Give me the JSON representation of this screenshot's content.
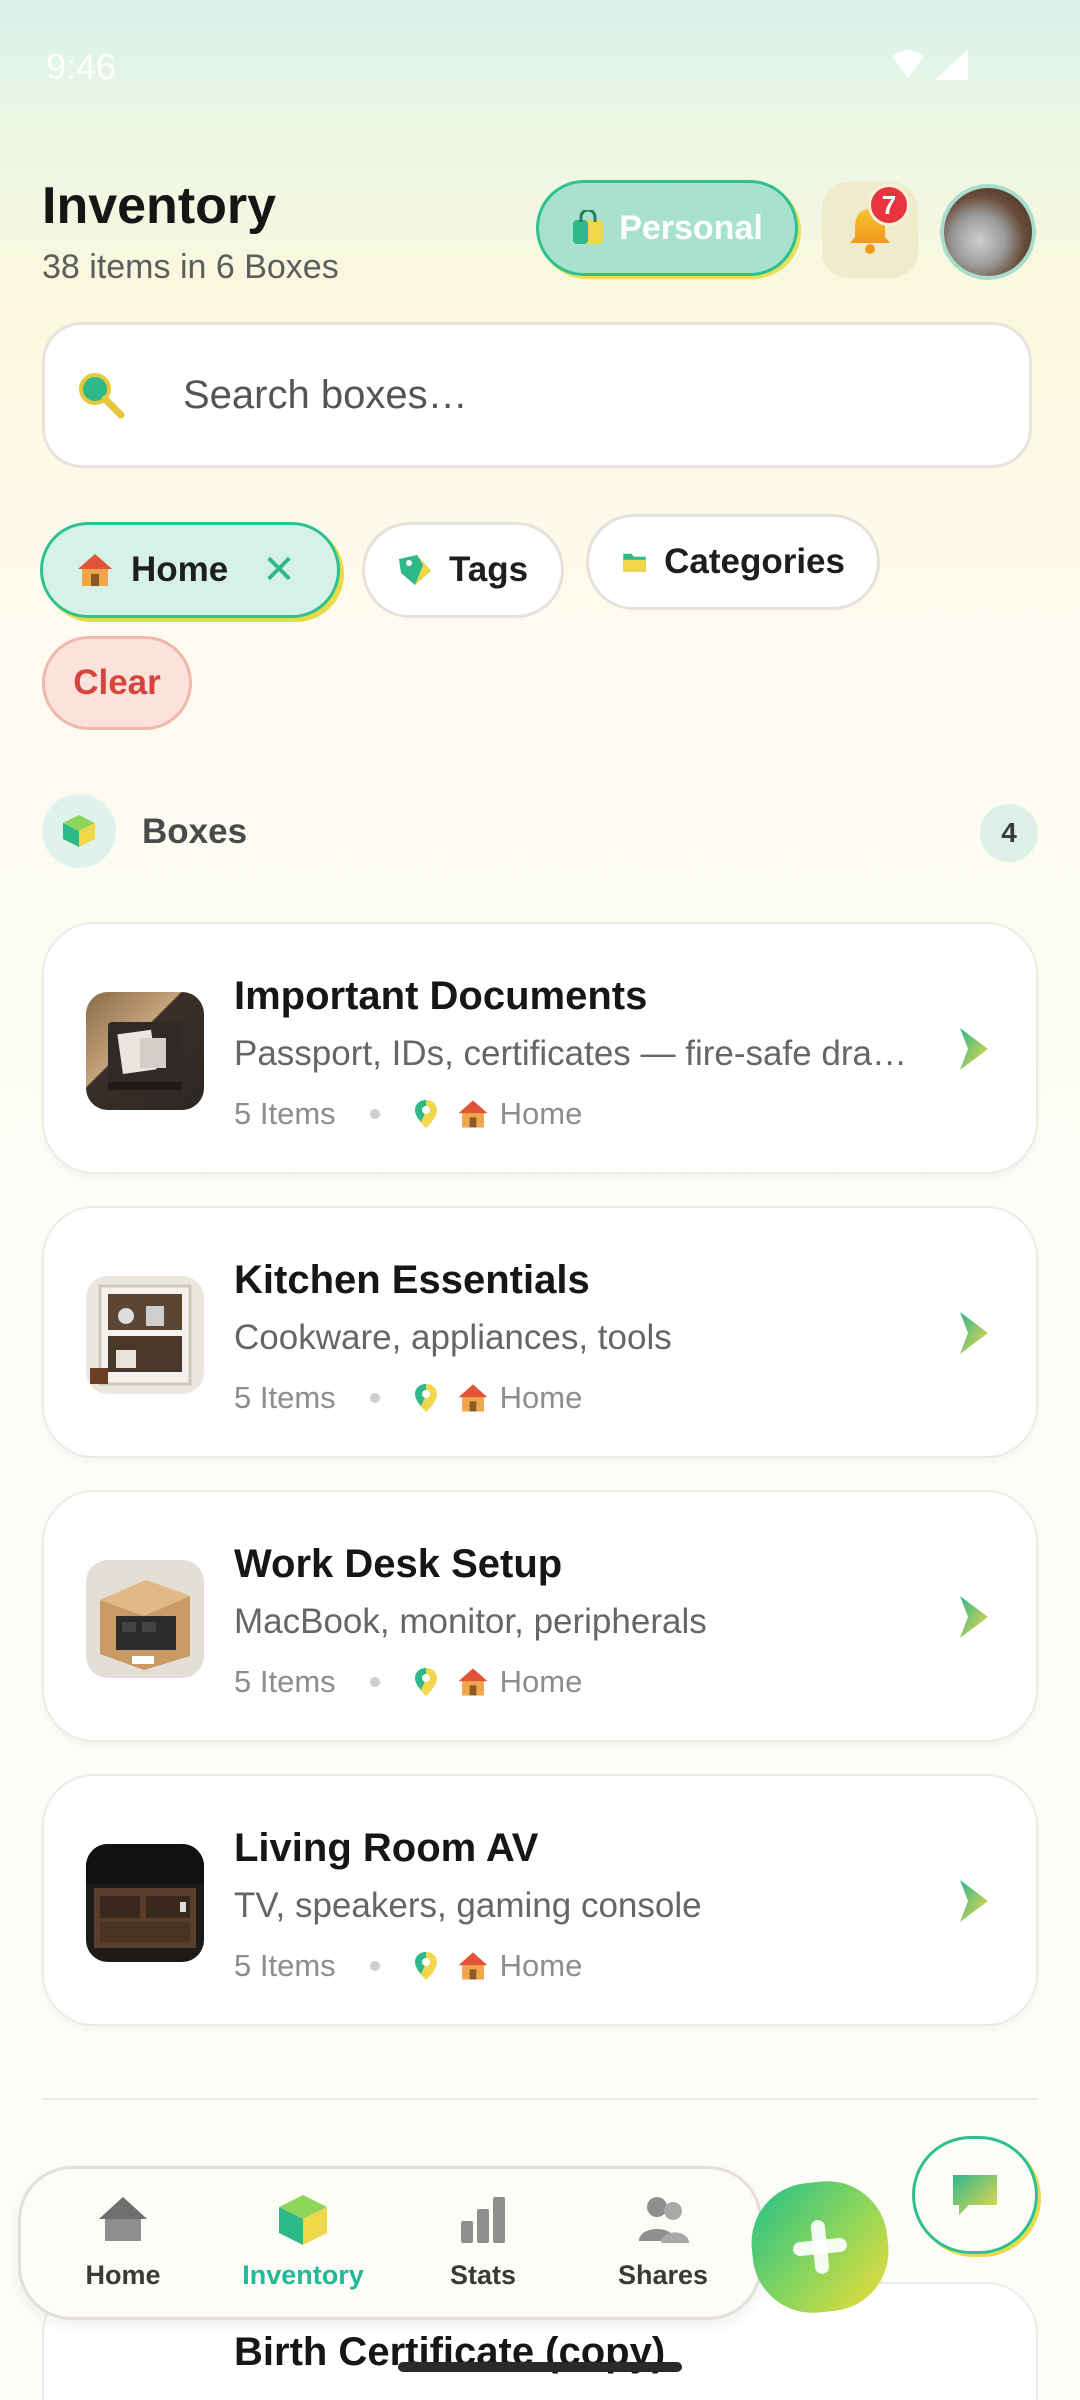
{
  "status_bar": {
    "time": "9:46"
  },
  "header": {
    "title": "Inventory",
    "subtitle": "38 items in 6 Boxes",
    "space_label": "Personal",
    "notification_count": "7"
  },
  "search": {
    "placeholder": "Search boxes…"
  },
  "filters": {
    "home_label": "Home",
    "tags_label": "Tags",
    "categories_label": "Categories",
    "clear_label": "Clear"
  },
  "section": {
    "title": "Boxes",
    "count": "4"
  },
  "boxes": [
    {
      "title": "Important Documents",
      "description": "Passport, IDs, certificates — fire-safe drawer",
      "items": "5 Items",
      "location": "Home"
    },
    {
      "title": "Kitchen Essentials",
      "description": "Cookware, appliances, tools",
      "items": "5 Items",
      "location": "Home"
    },
    {
      "title": "Work Desk Setup",
      "description": "MacBook, monitor, peripherals",
      "items": "5 Items",
      "location": "Home"
    },
    {
      "title": "Living Room AV",
      "description": "TV, speakers, gaming console",
      "items": "5 Items",
      "location": "Home"
    }
  ],
  "partial_item": {
    "title": "Birth Certificate (copy)"
  },
  "nav": {
    "items": [
      {
        "label": "Home",
        "icon": "home-icon"
      },
      {
        "label": "Inventory",
        "icon": "box-icon"
      },
      {
        "label": "Stats",
        "icon": "bar-chart-icon"
      },
      {
        "label": "Shares",
        "icon": "users-icon"
      }
    ],
    "active": "Inventory"
  },
  "colors": {
    "accent": "#22b89a",
    "accent_yellow": "#e6dc4a",
    "badge": "#e9343e",
    "clear": "#d6453b"
  }
}
